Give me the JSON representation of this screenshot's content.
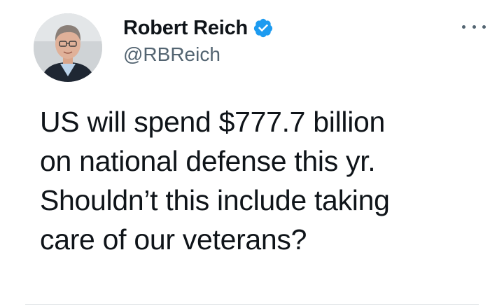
{
  "tweet": {
    "author": {
      "display_name": "Robert Reich",
      "handle": "@RBReich",
      "verified": true,
      "avatar_icon": "person-avatar"
    },
    "more_icon": "ellipsis-icon",
    "text": "US will spend $777.7 billion\non national defense this yr.\nShouldn’t this include taking\ncare of our veterans?"
  },
  "colors": {
    "verified_badge": "#1d9bf0",
    "handle_text": "#536471",
    "body_text": "#0f1419"
  }
}
